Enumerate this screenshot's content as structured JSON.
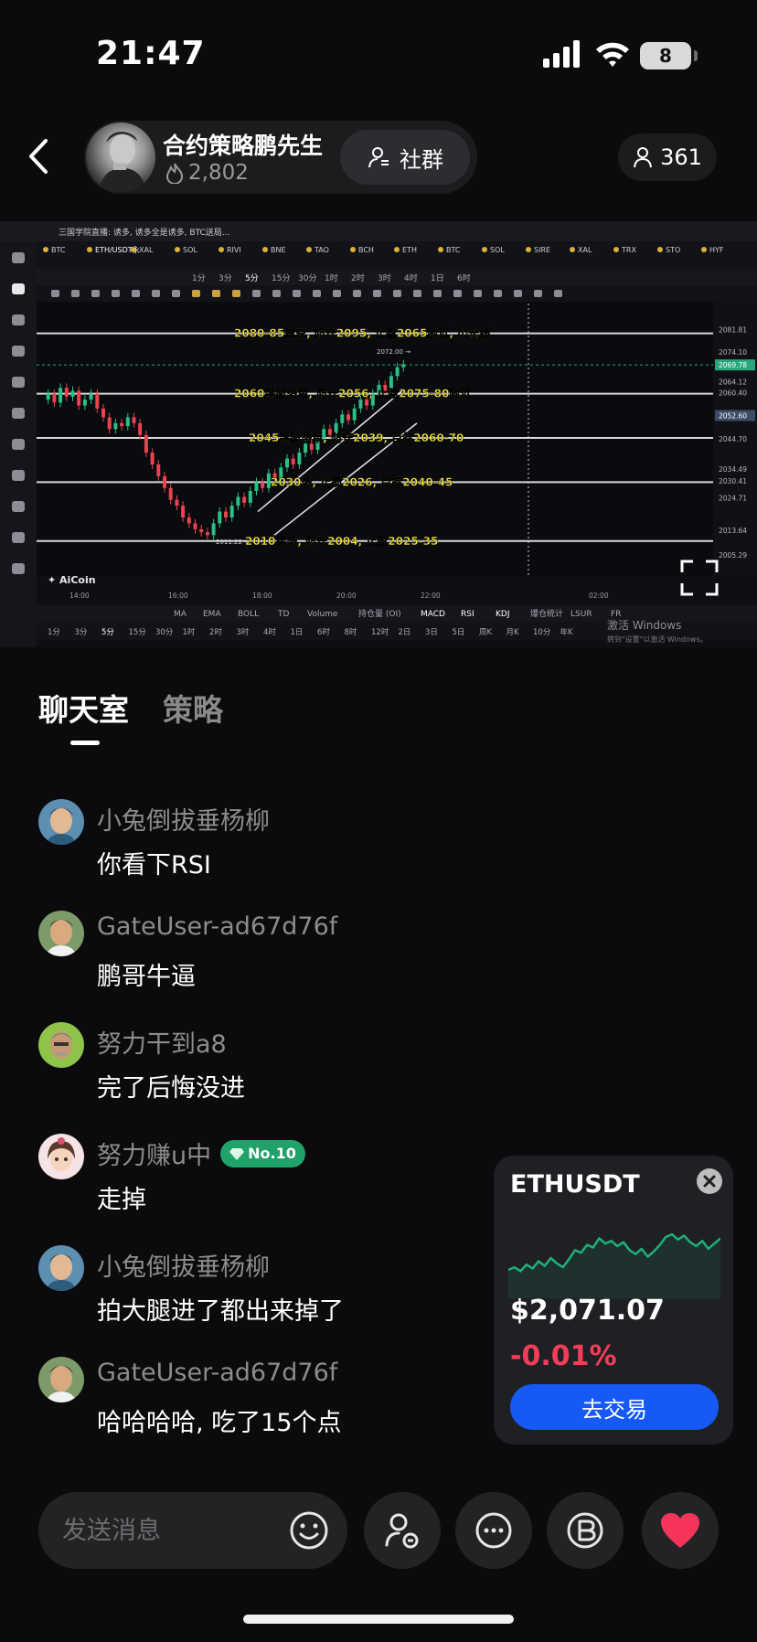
{
  "status_bar": {
    "time": "21:47",
    "battery": "8"
  },
  "header": {
    "host_name": "合约策略鹏先生",
    "likes": "2,802",
    "community_label": "社群",
    "viewers": "361"
  },
  "stream": {
    "window_title": "三国学院直播: 诱多, 诱多全是诱多, BTC送局...",
    "symbol_tab": "ETH/USDT永续",
    "tickers": [
      "BTC",
      "ETH/USDT永续",
      "XAL",
      "SOL",
      "RIVI",
      "BNE",
      "TAO",
      "BCH",
      "ETH",
      "BTC",
      "SOL",
      "SIRE",
      "XAL",
      "TRX",
      "STO",
      "HYF"
    ],
    "timeframes": [
      "1分",
      "3分",
      "5分",
      "15分",
      "30分",
      "1时",
      "2时",
      "3时",
      "4时",
      "1日",
      "6时"
    ],
    "annotations": [
      "2080-85做空, 防守2095, 止盈2065附近, 小长线",
      "2060突破多单, 防守2056, 止盈2075-80附近",
      "2045突破多单, 防守2039, 目标2060-70",
      "2030多, 止损2026, 目标2040-45",
      "2010接多, 防守2004, 止盈2025-35"
    ],
    "price_labels": [
      "2081.81",
      "2074.10",
      "2069.78",
      "2064.12",
      "2060.40",
      "2052.60",
      "2044.70",
      "2034.49",
      "2030.41",
      "2024.71",
      "2013.64",
      "2005.29"
    ],
    "high_label": "2072.00",
    "low_label": "2011.22",
    "time_ticks": [
      "14:00",
      "16:00",
      "18:00",
      "20:00",
      "22:00",
      "02:00"
    ],
    "brand": "AiCoin",
    "indicators": [
      "MA",
      "EMA",
      "BOLL",
      "TD",
      "Volume",
      "持仓量 (OI)",
      "MACD",
      "RSI",
      "KDJ",
      "爆仓统计",
      "LSUR",
      "FR"
    ],
    "bottom_timeframes": [
      "1分",
      "3分",
      "5分",
      "15分",
      "30分",
      "1时",
      "2时",
      "3时",
      "4时",
      "1日",
      "6时",
      "8时",
      "12时",
      "2日",
      "3日",
      "5日",
      "周K",
      "月K",
      "10分",
      "年K"
    ],
    "watermark": "激活 Windows",
    "watermark_sub": "转到\"设置\"以激活 Windows。"
  },
  "tabs": [
    {
      "label": "聊天室",
      "active": true
    },
    {
      "label": "策略",
      "active": false
    }
  ],
  "messages": [
    {
      "user": "小兔倒拔垂杨柳",
      "text": "你看下RSI",
      "avatar_color": "#3d6a8a"
    },
    {
      "user": "GateUser-ad67d76f",
      "text": "鹏哥牛逼",
      "avatar_color": "#4a6b3a"
    },
    {
      "user": "努力干到a8",
      "text": "完了后悔没进",
      "avatar_color": "#6fa23a"
    },
    {
      "user": "努力赚u中",
      "text": "走掉",
      "badge": "No.10",
      "avatar_color": "#e8c7b0"
    },
    {
      "user": "小兔倒拔垂杨柳",
      "text": "拍大腿进了都出来掉了",
      "avatar_color": "#3d6a8a"
    },
    {
      "user": "GateUser-ad67d76f",
      "text": "哈哈哈哈, 吃了15个点",
      "avatar_color": "#4a6b3a"
    }
  ],
  "ticker_card": {
    "symbol": "ETHUSDT",
    "price": "$2,071.07",
    "change": "-0.01%",
    "button": "去交易",
    "spark": [
      0.32,
      0.36,
      0.3,
      0.4,
      0.34,
      0.45,
      0.38,
      0.5,
      0.42,
      0.36,
      0.48,
      0.62,
      0.58,
      0.7,
      0.66,
      0.8,
      0.72,
      0.76,
      0.68,
      0.74,
      0.62,
      0.56,
      0.64,
      0.52,
      0.6,
      0.7,
      0.82,
      0.86,
      0.78,
      0.84,
      0.74,
      0.68,
      0.76,
      0.64,
      0.72,
      0.8
    ],
    "colors": {
      "up": "#1fb07a",
      "down": "#f23d58"
    }
  },
  "bottom_bar": {
    "placeholder": "发送消息"
  }
}
